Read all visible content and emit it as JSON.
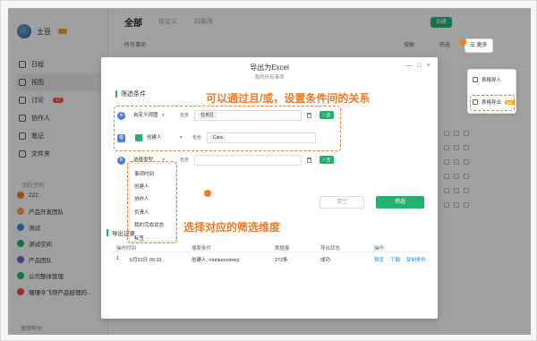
{
  "app": {
    "user_name": "土豆",
    "nav": [
      {
        "label": "日程"
      },
      {
        "label": "视图",
        "active": true
      },
      {
        "label": "讨论",
        "badge": "17"
      },
      {
        "label": "协作人"
      },
      {
        "label": "笔记"
      },
      {
        "label": "文件夹"
      }
    ],
    "team_section_title": "团队空间",
    "teams": [
      {
        "label": "222",
        "color": "#f07a26"
      },
      {
        "label": "产品开发团队",
        "color": "#f0a030"
      },
      {
        "label": "测试",
        "color": "#4a7fd8"
      },
      {
        "label": "测试空间",
        "color": "#21b26f"
      },
      {
        "label": "产品团队",
        "color": "#7a5cc8"
      },
      {
        "label": "公司整体管理",
        "color": "#21b26f"
      },
      {
        "label": "珊珊令飞项产品经理的...",
        "color": "#e44"
      }
    ],
    "help_label": "使用帮助",
    "tabs": [
      "全部",
      "自定义",
      "四象限"
    ],
    "create_label": "创建",
    "sub_filter": "所有事项",
    "search_label": "搜索",
    "filter_label": "筛选",
    "more_label": "更多",
    "more_menu": {
      "items": [
        {
          "label": "表格导入"
        },
        {
          "label": "表格导出",
          "badge": "pro"
        }
      ]
    }
  },
  "modal": {
    "title": "导出为Excel",
    "subtitle": "我的所有事项",
    "win_controls": [
      "—",
      "□",
      "×"
    ],
    "filter_section": "筛选条件",
    "rows": [
      {
        "logic": "A",
        "field": "自定义视图",
        "op": "包含",
        "value": "任务区"
      },
      {
        "logic": "或",
        "field": "创建人",
        "op": "包含",
        "value": "Cara"
      },
      {
        "logic": "B",
        "field": "选择类型",
        "op": "包含",
        "value": ""
      }
    ],
    "add_label": "+ 且",
    "field_options": [
      "事项时间",
      "创建人",
      "协作人",
      "负责人",
      "我的完成状态",
      "标签"
    ],
    "clear_label": "清空",
    "filter_button": "筛选",
    "history_section": "导出记录",
    "table_headers": [
      "操作时间",
      "搜索条件",
      "数据量",
      "导出状态",
      "操作"
    ],
    "table_row": {
      "index": "1",
      "time": "5月31日 09:33",
      "condition": "创建人: niuniunosleep",
      "count": "272条",
      "status": "成功",
      "actions": [
        "预览",
        "下载",
        "复制条件"
      ]
    }
  },
  "annotations": {
    "top": "可以通过且/或，设置条件间的关系",
    "bottom": "选择对应的筛选维度"
  }
}
